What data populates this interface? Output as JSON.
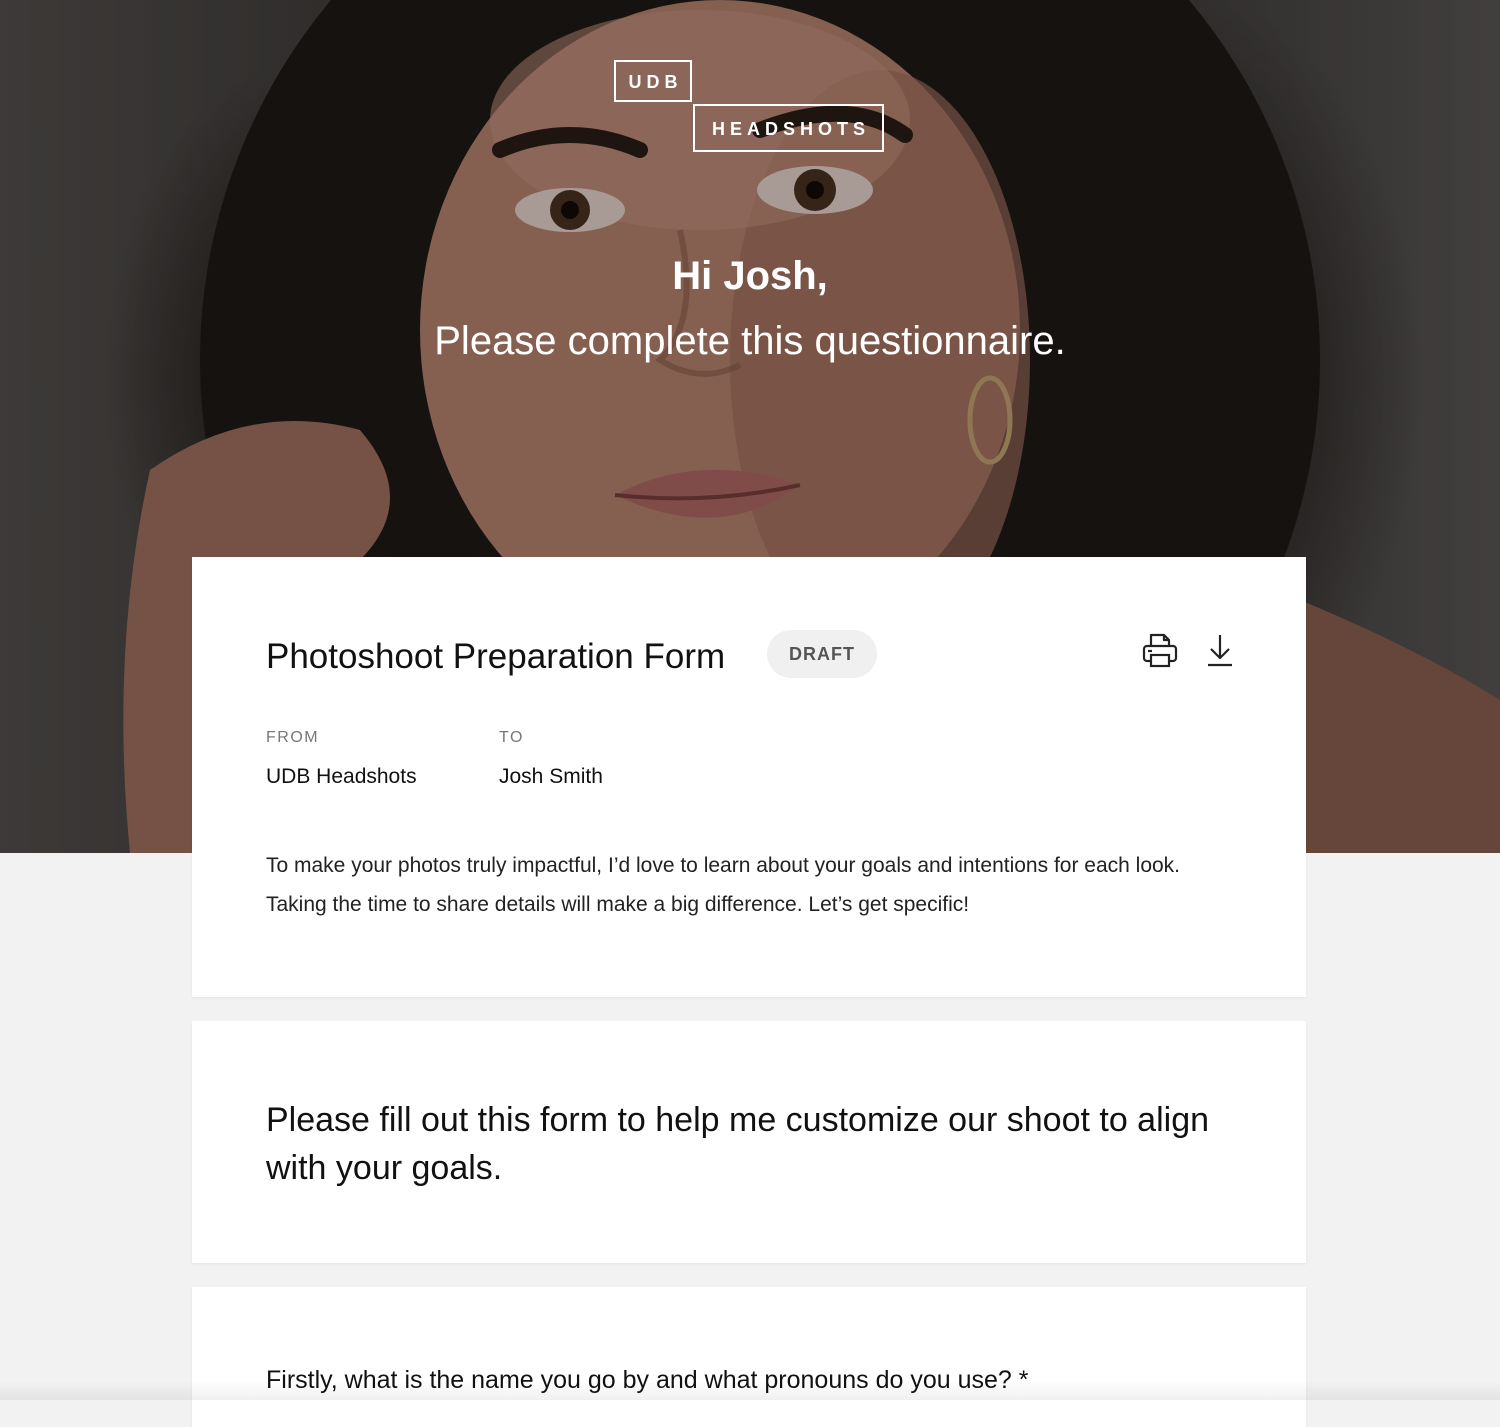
{
  "brand": {
    "logo_line1": "UDB",
    "logo_line2": "HEADSHOTS"
  },
  "hero": {
    "greeting": "Hi Josh,",
    "subtitle": "Please complete this questionnaire."
  },
  "form": {
    "title": "Photoshoot Preparation Form",
    "status_badge": "DRAFT",
    "from_label": "FROM",
    "from_value": "UDB Headshots",
    "to_label": "TO",
    "to_value": "Josh Smith",
    "description": "To make your photos truly impactful, I’d love to learn about your goals and intentions for each look. Taking the time to share details will make a big difference. Let’s get specific!",
    "print_icon": "printer-icon",
    "download_icon": "download-icon"
  },
  "intro": {
    "text": "Please fill out this form to help me customize our shoot to align with your goals."
  },
  "questions": [
    {
      "text": "Firstly, what is the name you go by and what pronouns do you use? *"
    }
  ]
}
